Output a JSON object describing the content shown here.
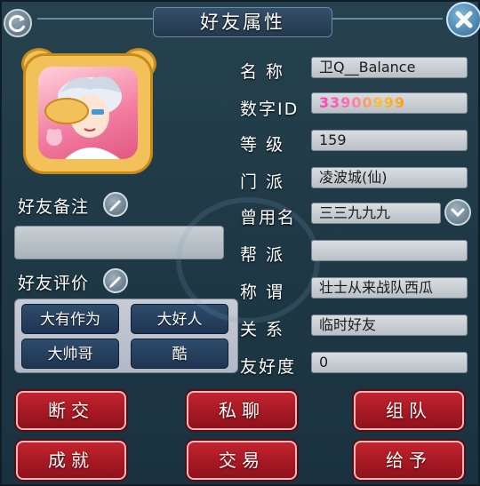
{
  "window": {
    "title": "好友属性"
  },
  "profile": {
    "fields": [
      {
        "label": "名 称",
        "value": "卫Q__Balance"
      },
      {
        "label": "数字ID",
        "value": "33900999"
      },
      {
        "label": "等 级",
        "value": "159"
      },
      {
        "label": "门 派",
        "value": "凌波城(仙)"
      },
      {
        "label": "曾用名",
        "value": "三三九九九"
      },
      {
        "label": "帮 派",
        "value": ""
      },
      {
        "label": "称 谓",
        "value": "壮士从来战队西瓜"
      },
      {
        "label": "关 系",
        "value": "临时好友"
      },
      {
        "label": "友好度",
        "value": "0"
      }
    ]
  },
  "memo": {
    "label": "好友备注",
    "value": ""
  },
  "rating": {
    "label": "好友评价",
    "tags": [
      "大有作为",
      "大好人",
      "大帅哥",
      "酷"
    ]
  },
  "actions": [
    "断交",
    "私聊",
    "组队",
    "成就",
    "交易",
    "给予"
  ],
  "icons": {
    "refresh": "refresh-icon",
    "close": "close-icon",
    "pencil": "pencil-icon",
    "dropdown": "chevron-down-icon",
    "avatar": "character-portrait"
  },
  "colors": {
    "panel": "#1f3947",
    "button": "#a5151f",
    "tag": "#1e3552",
    "field": "#c9ced3"
  }
}
